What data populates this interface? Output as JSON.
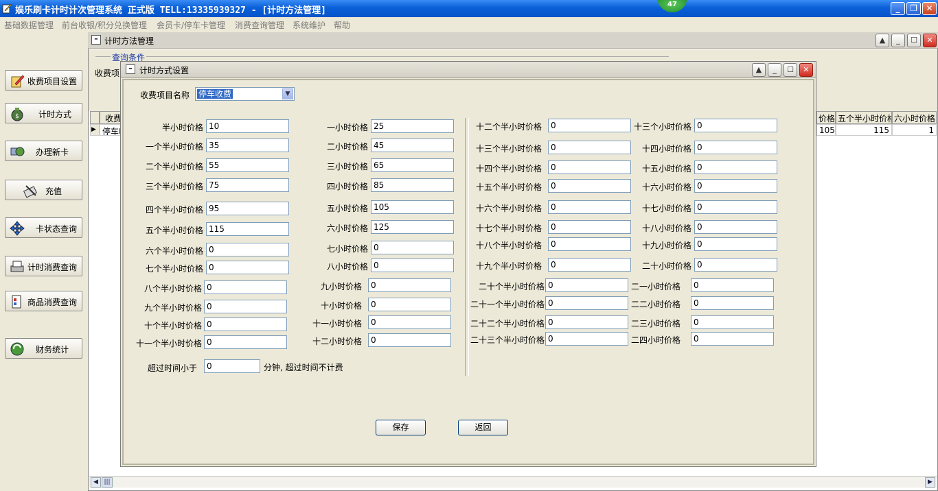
{
  "app": {
    "title": "娱乐刷卡计时计次管理系统 正式版 TELL:13335939327 - [计时方法管理]",
    "badge": "47",
    "accent_color": "#0a5fd8"
  },
  "menu": [
    "基础数据管理",
    "前台收银/积分兑换管理",
    "会员卡/停车卡管理",
    "消费查询管理",
    "系统维护",
    "帮助"
  ],
  "sidebar": [
    {
      "label": "收费项目设置",
      "icon": "pencil-book-icon"
    },
    {
      "label": "计时方式",
      "icon": "money-bag-icon"
    },
    {
      "label": "办理新卡",
      "icon": "card-globe-icon"
    },
    {
      "label": "充值",
      "icon": "card-swipe-icon"
    },
    {
      "label": "卡状态查询",
      "icon": "move-arrows-icon"
    },
    {
      "label": "计时消费查询",
      "icon": "printer-icon"
    },
    {
      "label": "商品消费查询",
      "icon": "document-icon"
    },
    {
      "label": "财务统计",
      "icon": "refresh-gear-icon"
    }
  ],
  "window": {
    "title": "计时方法管理",
    "query_group": "查询条件",
    "query_label": "收费项",
    "grid_headers": [
      "收费",
      "价格",
      "五个半小时价格",
      "六小时价格"
    ],
    "grid_row": [
      "停车收",
      "105",
      "115",
      "1"
    ]
  },
  "dialog": {
    "title": "计时方式设置",
    "item_label": "收费项目名称",
    "item_value": "停车收费",
    "overtime_label": "超过时间小于",
    "overtime_value": "0",
    "overtime_suffix": "分钟, 超过时间不计费",
    "save": "保存",
    "back": "返回",
    "fields": [
      {
        "label": "半小时价格",
        "value": "10"
      },
      {
        "label": "一小时价格",
        "value": "25"
      },
      {
        "label": "十二个半小时价格",
        "value": "0"
      },
      {
        "label": "十三个小时价格",
        "value": "0"
      },
      {
        "label": "一个半小时价格",
        "value": "35"
      },
      {
        "label": "二小时价格",
        "value": "45"
      },
      {
        "label": "十三个半小时价格",
        "value": "0"
      },
      {
        "label": "十四小时价格",
        "value": "0"
      },
      {
        "label": "二个半小时价格",
        "value": "55"
      },
      {
        "label": "三小时价格",
        "value": "65"
      },
      {
        "label": "十四个半小时价格",
        "value": "0"
      },
      {
        "label": "十五小时价格",
        "value": "0"
      },
      {
        "label": "三个半小时价格",
        "value": "75"
      },
      {
        "label": "四小时价格",
        "value": "85"
      },
      {
        "label": "十五个半小时价格",
        "value": "0"
      },
      {
        "label": "十六小时价格",
        "value": "0"
      },
      {
        "label": "四个半小时价格",
        "value": "95"
      },
      {
        "label": "五小时价格",
        "value": "105"
      },
      {
        "label": "十六个半小时价格",
        "value": "0"
      },
      {
        "label": "十七小时价格",
        "value": "0"
      },
      {
        "label": "五个半小时价格",
        "value": "115"
      },
      {
        "label": "六小时价格",
        "value": "125"
      },
      {
        "label": "十七个半小时价格",
        "value": "0"
      },
      {
        "label": "十八小时价格",
        "value": "0"
      },
      {
        "label": "六个半小时价格",
        "value": "0"
      },
      {
        "label": "七小时价格",
        "value": "0"
      },
      {
        "label": "十八个半小时价格",
        "value": "0"
      },
      {
        "label": "十九小时价格",
        "value": "0"
      },
      {
        "label": "七个半小时价格",
        "value": "0"
      },
      {
        "label": "八小时价格",
        "value": "0"
      },
      {
        "label": "十九个半小时价格",
        "value": "0"
      },
      {
        "label": "二十小时价格",
        "value": "0"
      },
      {
        "label": "八个半小时价格",
        "value": "0"
      },
      {
        "label": "九小时价格",
        "value": "0"
      },
      {
        "label": "二十个半小时价格",
        "value": "0"
      },
      {
        "label": "二一小时价格",
        "value": "0"
      },
      {
        "label": "九个半小时价格",
        "value": "0"
      },
      {
        "label": "十小时价格",
        "value": "0"
      },
      {
        "label": "二十一个半小时价格",
        "value": "0"
      },
      {
        "label": "二二小时价格",
        "value": "0"
      },
      {
        "label": "十个半小时价格",
        "value": "0"
      },
      {
        "label": "十一小时价格",
        "value": "0"
      },
      {
        "label": "二十二个半小时价格",
        "value": "0"
      },
      {
        "label": "二三小时价格",
        "value": "0"
      },
      {
        "label": "十一个半小时价格",
        "value": "0"
      },
      {
        "label": "十二小时价格",
        "value": "0"
      },
      {
        "label": "二十三个半小时价格",
        "value": "0"
      },
      {
        "label": "二四小时价格",
        "value": "0"
      }
    ]
  }
}
